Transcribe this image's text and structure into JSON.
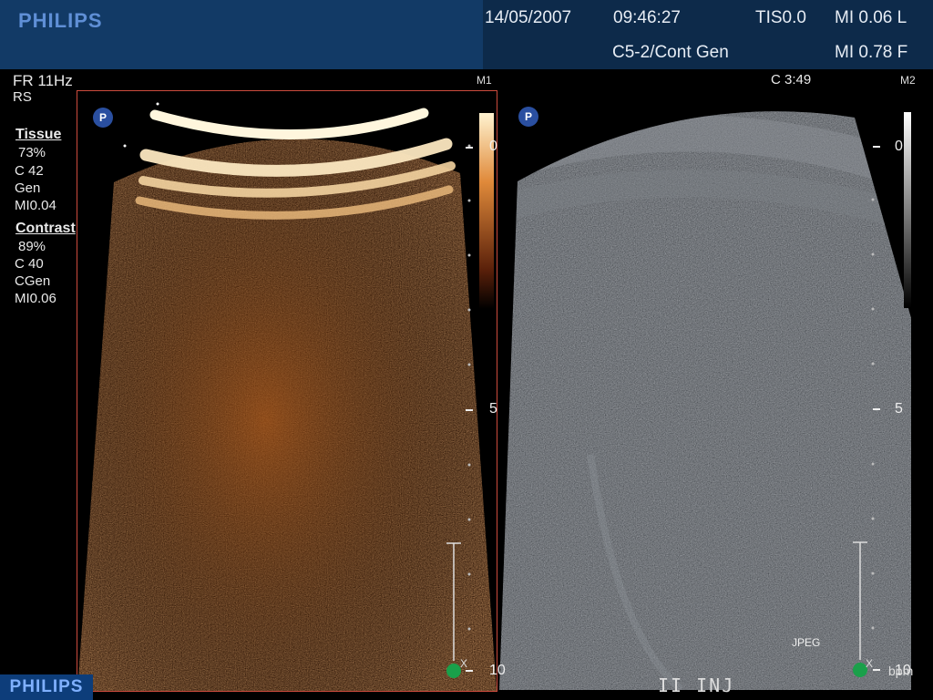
{
  "header": {
    "brand": "PHILIPS",
    "date": "14/05/2007",
    "time": "09:46:27",
    "tis": "TIS0.0",
    "mi_top": "MI 0.06 L",
    "probe": "C5-2/Cont Gen",
    "mi_bottom": "MI 0.78 F"
  },
  "left_info": {
    "fr": "FR 11Hz",
    "rs": "RS",
    "tissue_title": "Tissue",
    "tissue_pct": "73%",
    "tissue_c": "C 42",
    "tissue_gen": "Gen",
    "tissue_mi": "MI0.04",
    "contrast_title": "Contrast",
    "contrast_pct": "89%",
    "contrast_c": "C 40",
    "contrast_gen": "CGen",
    "contrast_mi": "MI0.06"
  },
  "panels": {
    "left_label": "M1",
    "right_label": "M2",
    "clock": "C 3:49",
    "marker_p": "P",
    "scale_0": "0",
    "scale_5": "5",
    "scale_10": "10",
    "x_label": "X",
    "jpeg": "JPEG",
    "bpm": "bpm",
    "inj": "II INJ"
  },
  "footer": {
    "brand": "PHILIPS"
  },
  "colors": {
    "header_bg": "#0d2a4a",
    "header_logo_bg": "#123a66",
    "brand_blue": "#5f8fd6",
    "panel_border": "#cc4b3d",
    "contrast_tint": "#b85a1c",
    "b_mode_tint": "#6b6f75",
    "marker_green": "#1aa04a"
  }
}
